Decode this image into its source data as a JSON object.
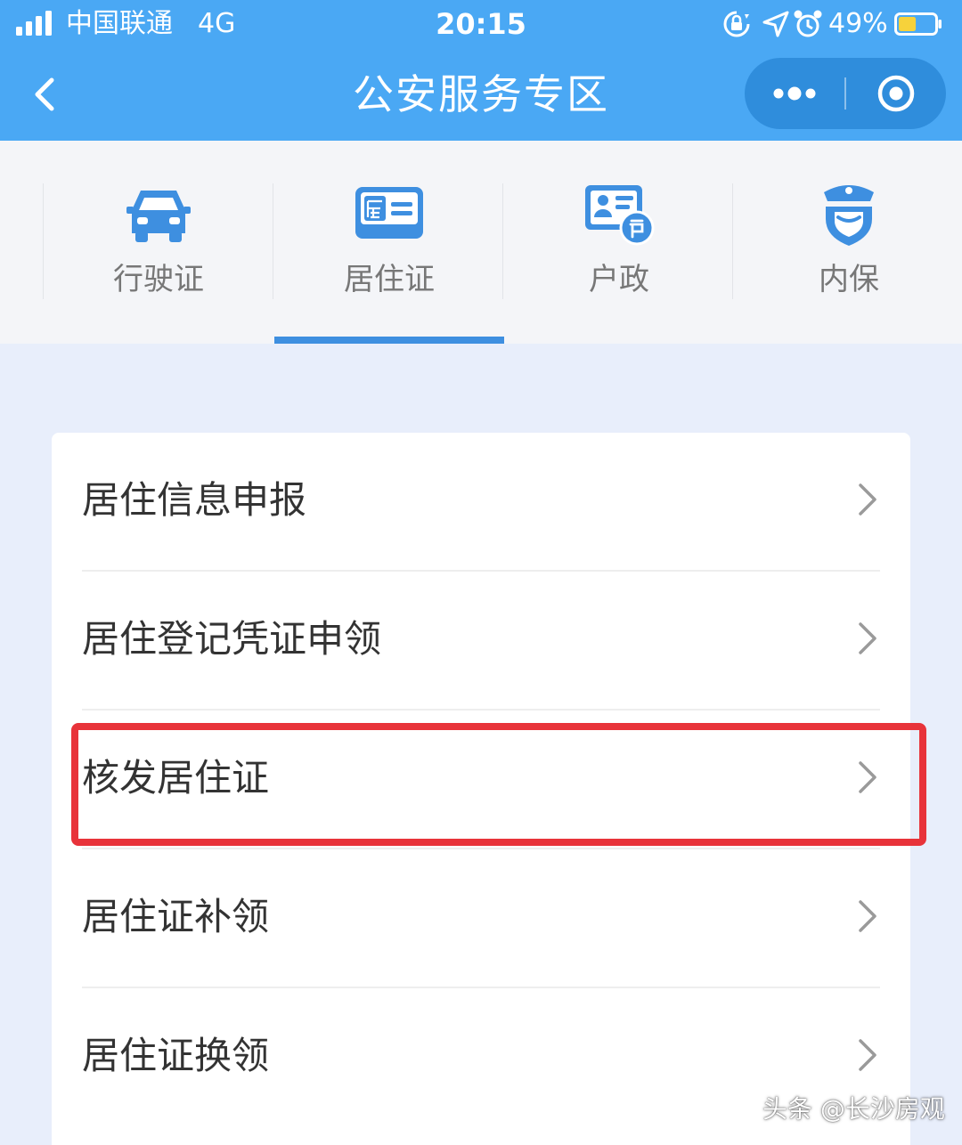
{
  "status_bar": {
    "carrier": "中国联通",
    "network": "4G",
    "time": "20:15",
    "battery_percent": "49%",
    "battery_level": 0.49,
    "icons": [
      "signal-icon",
      "rotation-lock-icon",
      "location-icon",
      "alarm-icon",
      "battery-icon"
    ]
  },
  "nav": {
    "back_icon": "chevron-left-icon",
    "title": "公安服务专区",
    "more_icon": "more-dots-icon",
    "target_icon": "target-icon"
  },
  "tabs": [
    {
      "label": "行驶证",
      "icon": "car-icon"
    },
    {
      "label": "居住证",
      "icon": "residence-card-icon"
    },
    {
      "label": "户政",
      "icon": "household-register-icon"
    },
    {
      "label": "内保",
      "icon": "police-shield-icon"
    }
  ],
  "active_tab": "居住证",
  "services": [
    {
      "label": "居住信息申报"
    },
    {
      "label": "居住登记凭证申领"
    },
    {
      "label": "核发居住证"
    },
    {
      "label": "居住证补领"
    },
    {
      "label": "居住证换领"
    }
  ],
  "highlighted_service": "核发居住证",
  "colors": {
    "header": "#4AA8F4",
    "accent": "#3E8FE0",
    "highlight": "#E8333A",
    "page_bg": "#E8EEFB"
  },
  "watermark": "头条 @长沙房观"
}
